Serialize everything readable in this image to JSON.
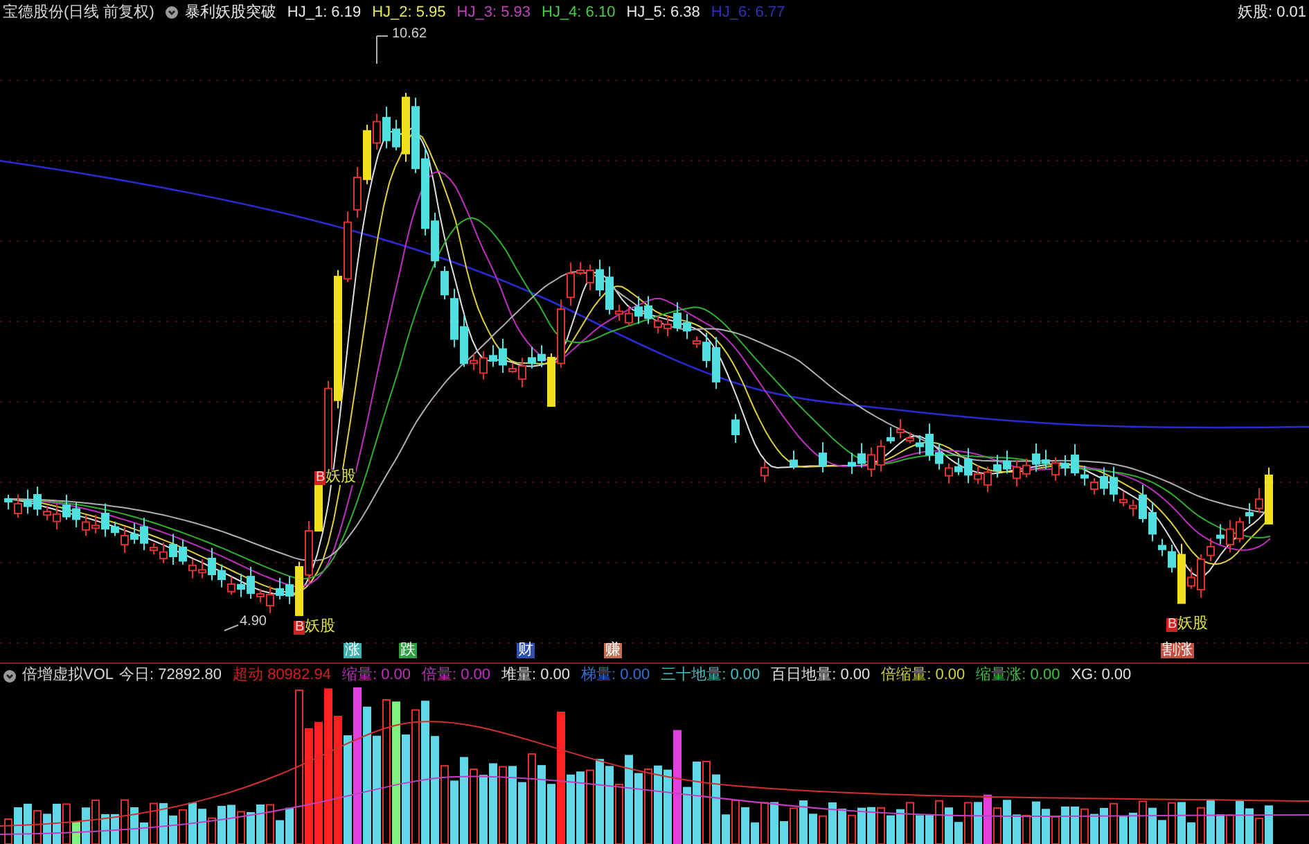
{
  "price_panel": {
    "title": "宝德股份(日线 前复权)",
    "indicator": "暴利妖股突破",
    "readouts": [
      {
        "text": "HJ_1: 6.19",
        "color": "#e8e8e8"
      },
      {
        "text": "HJ_2: 5.95",
        "color": "#e8e850"
      },
      {
        "text": "HJ_3: 5.93",
        "color": "#c040c0"
      },
      {
        "text": "HJ_4: 6.10",
        "color": "#40d040"
      },
      {
        "text": "HJ_5: 6.38",
        "color": "#e8e8e8"
      },
      {
        "text": "HJ_6: 6.77",
        "color": "#3030c0"
      },
      {
        "text": "妖股: 0.01",
        "color": "#e8e8e8"
      }
    ],
    "price_labels": [
      "10.62",
      "4.90"
    ],
    "signals": [
      {
        "badge": "B",
        "text": "妖股"
      },
      {
        "badge": "B",
        "text": "妖股"
      },
      {
        "badge": "B",
        "text": "妖股"
      }
    ],
    "markers": [
      {
        "text": "涨",
        "color": "#40b0b0"
      },
      {
        "text": "跌",
        "color": "#30a040"
      },
      {
        "text": "财",
        "color": "#3050b0"
      },
      {
        "text": "赚",
        "color": "#c07050"
      },
      {
        "text": "割涨",
        "color": "#c05040"
      }
    ]
  },
  "volume_panel": {
    "title": "倍增虚拟VOL",
    "today": "今日: 72892.80",
    "readouts": [
      {
        "text": "超动 80982.94",
        "color": "#d02020"
      },
      {
        "text": "缩量: 0.00",
        "color": "#c030c0"
      },
      {
        "text": "倍量: 0.00",
        "color": "#c030c0"
      },
      {
        "text": "堆量: 0.00",
        "color": "#e0e0e0"
      },
      {
        "text": "梯量: 0.00",
        "color": "#3070d0"
      },
      {
        "text": "三十地量: 0.00",
        "color": "#40c0c0"
      },
      {
        "text": "百日地量: 0.00",
        "color": "#e0e0e0"
      },
      {
        "text": "倍缩量: 0.00",
        "color": "#d0d040"
      },
      {
        "text": "缩量涨: 0.00",
        "color": "#40c040"
      },
      {
        "text": "XG: 0.00",
        "color": "#e0e0e0"
      }
    ]
  }
}
